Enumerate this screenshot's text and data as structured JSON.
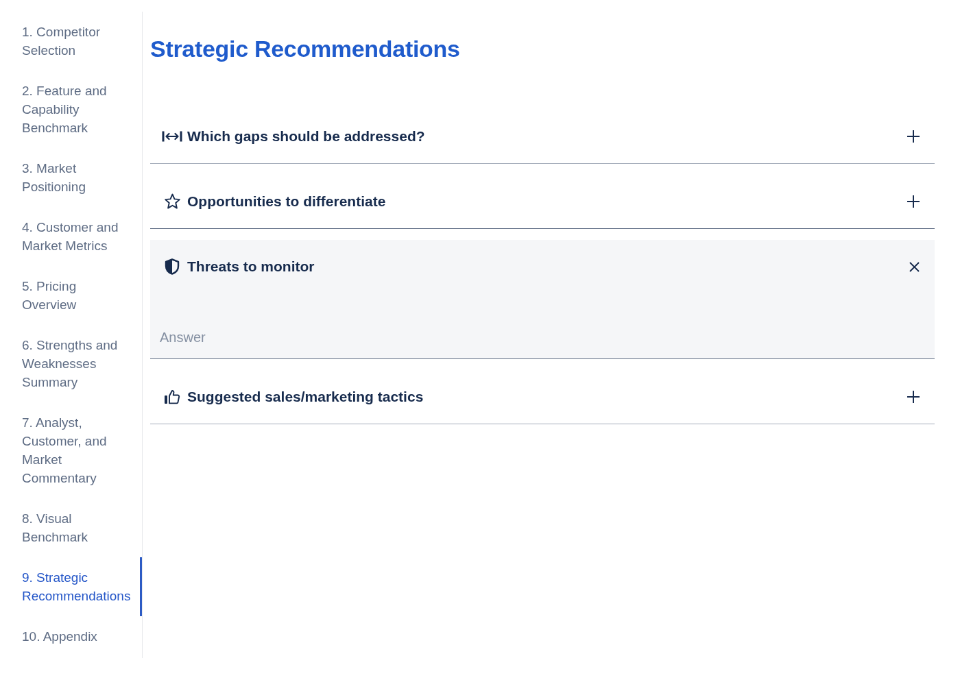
{
  "sidebar": {
    "items": [
      {
        "label": "1. Competitor Selection",
        "selected": false
      },
      {
        "label": "2. Feature and Capability Benchmark",
        "selected": false
      },
      {
        "label": "3. Market Positioning",
        "selected": false
      },
      {
        "label": "4. Customer and Market Metrics",
        "selected": false
      },
      {
        "label": "5. Pricing Overview",
        "selected": false
      },
      {
        "label": "6. Strengths and Weaknesses Summary",
        "selected": false
      },
      {
        "label": "7. Analyst, Customer, and Market Commentary",
        "selected": false
      },
      {
        "label": "8. Visual Benchmark",
        "selected": false
      },
      {
        "label": "9. Strategic Recommendations",
        "selected": true
      },
      {
        "label": "10. Appendix",
        "selected": false
      }
    ]
  },
  "page_title": "Strategic Recommendations",
  "sections": [
    {
      "title": "Which gaps should be addressed?",
      "expanded": false
    },
    {
      "title": "Opportunities to differentiate",
      "expanded": false
    },
    {
      "title": "Threats to monitor",
      "expanded": true,
      "answer": {
        "placeholder": "Answer"
      }
    },
    {
      "title": "Suggested sales/marketing tactics",
      "expanded": false
    }
  ]
}
